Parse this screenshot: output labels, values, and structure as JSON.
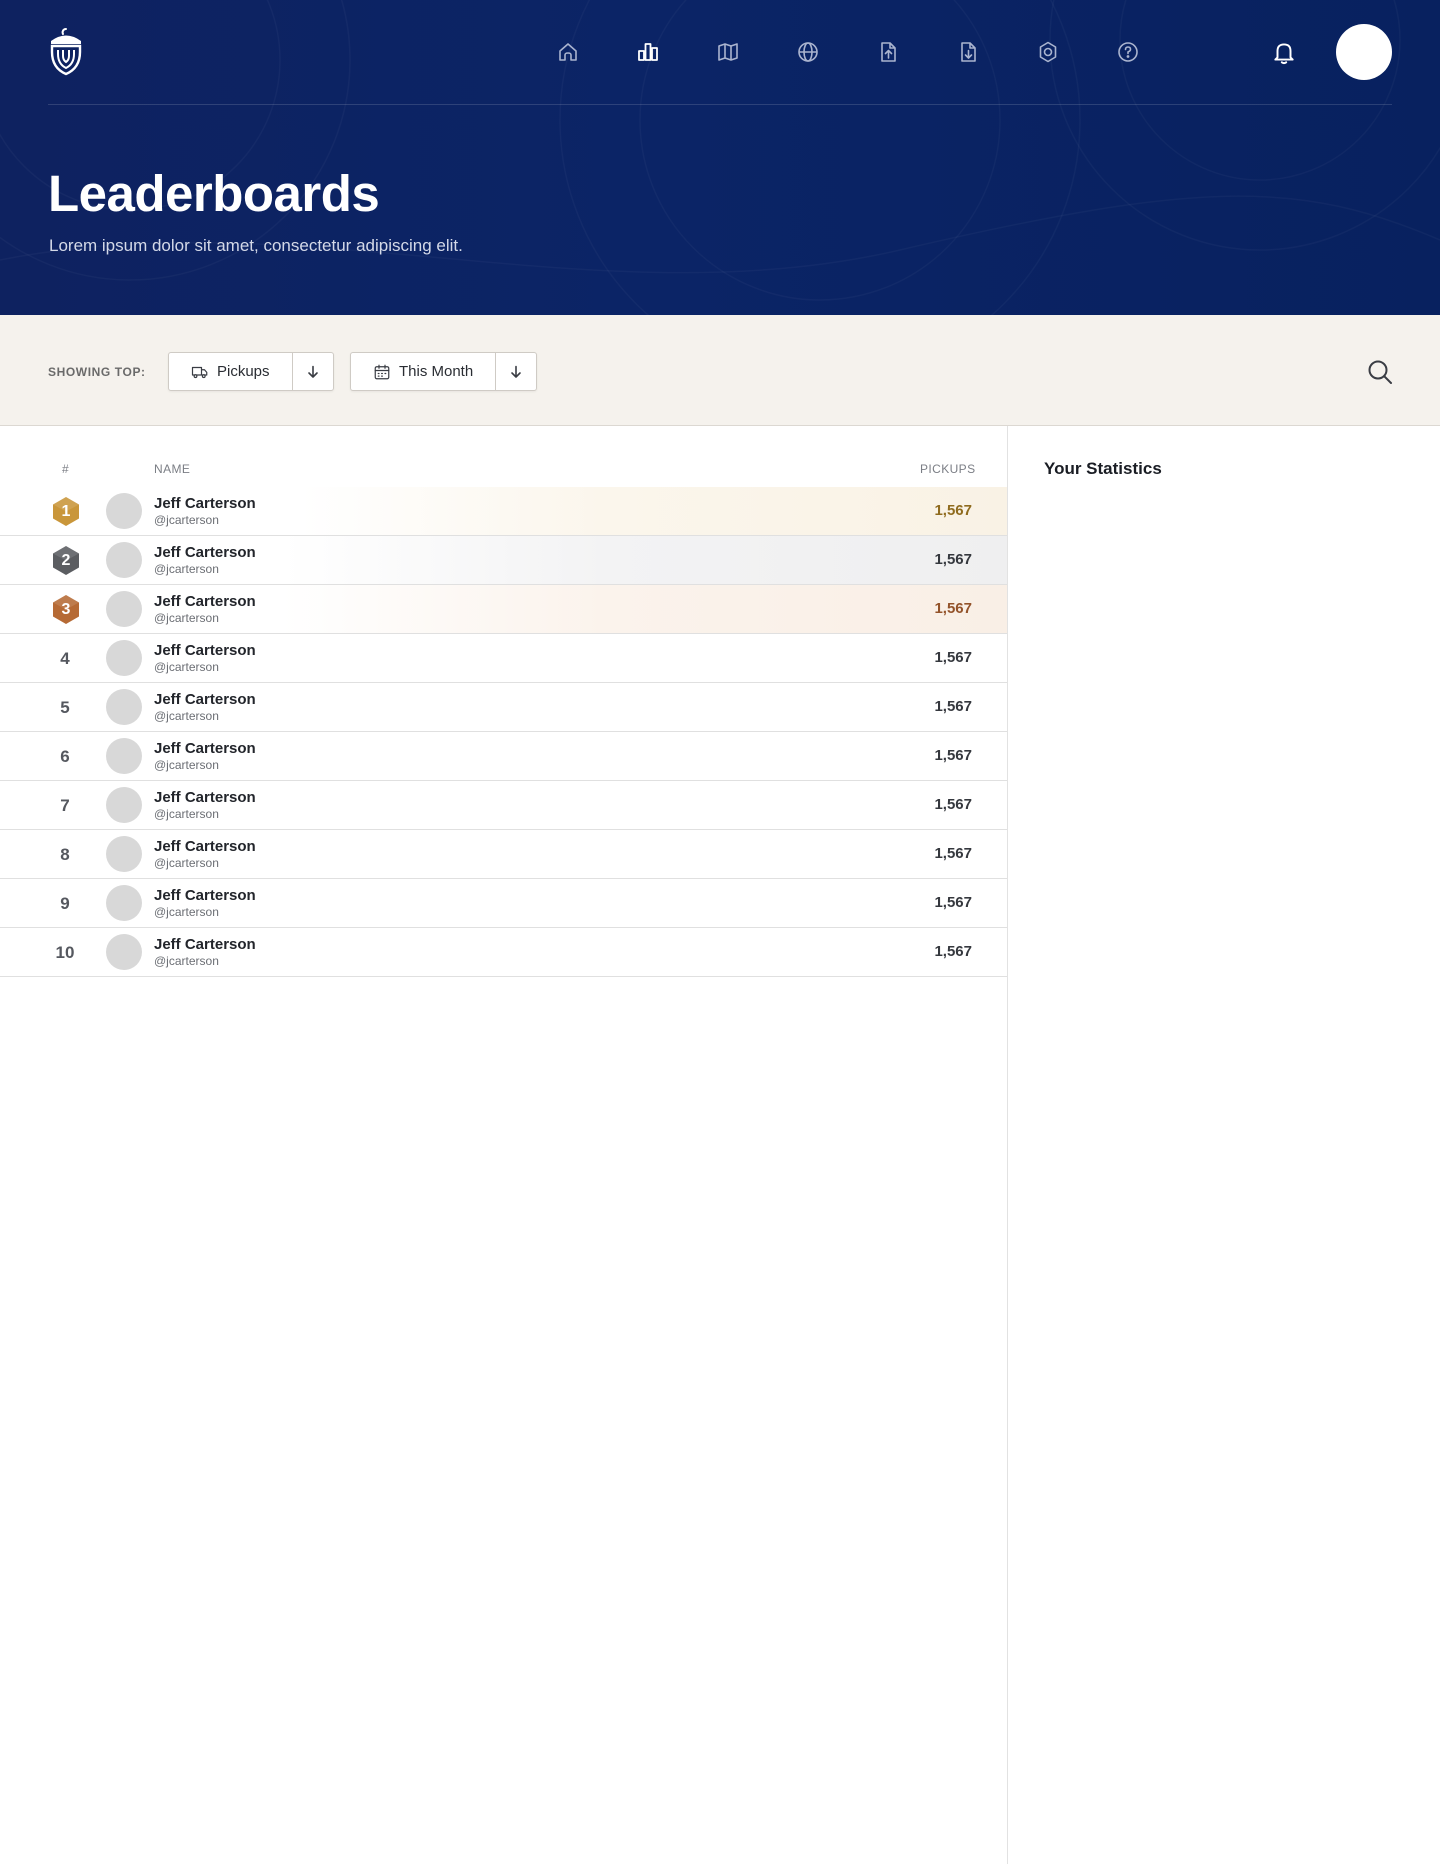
{
  "header": {
    "title": "Leaderboards",
    "subtitle": "Lorem ipsum dolor sit amet, consectetur adipiscing elit."
  },
  "nav": {
    "items": [
      {
        "icon": "home-icon",
        "active": false
      },
      {
        "icon": "leaderboard-icon",
        "active": true
      },
      {
        "icon": "map-icon",
        "active": false
      },
      {
        "icon": "globe-icon",
        "active": false
      },
      {
        "icon": "file-upload-icon",
        "active": false
      },
      {
        "icon": "file-download-icon",
        "active": false
      },
      {
        "icon": "settings-icon",
        "active": false
      },
      {
        "icon": "help-icon",
        "active": false
      }
    ]
  },
  "filters": {
    "showing_label": "SHOWING TOP:",
    "metric": {
      "label": "Pickups",
      "icon": "truck-icon"
    },
    "period": {
      "label": "This Month",
      "icon": "calendar-icon"
    }
  },
  "table": {
    "headers": {
      "rank": "#",
      "name": "NAME",
      "metric": "PICKUPS"
    },
    "rows": [
      {
        "rank": "1",
        "name": "Jeff Carterson",
        "handle": "@jcarterson",
        "value": "1,567",
        "medal": "gold"
      },
      {
        "rank": "2",
        "name": "Jeff Carterson",
        "handle": "@jcarterson",
        "value": "1,567",
        "medal": "silver"
      },
      {
        "rank": "3",
        "name": "Jeff Carterson",
        "handle": "@jcarterson",
        "value": "1,567",
        "medal": "bronze"
      },
      {
        "rank": "4",
        "name": "Jeff Carterson",
        "handle": "@jcarterson",
        "value": "1,567",
        "medal": ""
      },
      {
        "rank": "5",
        "name": "Jeff Carterson",
        "handle": "@jcarterson",
        "value": "1,567",
        "medal": ""
      },
      {
        "rank": "6",
        "name": "Jeff Carterson",
        "handle": "@jcarterson",
        "value": "1,567",
        "medal": ""
      },
      {
        "rank": "7",
        "name": "Jeff Carterson",
        "handle": "@jcarterson",
        "value": "1,567",
        "medal": ""
      },
      {
        "rank": "8",
        "name": "Jeff Carterson",
        "handle": "@jcarterson",
        "value": "1,567",
        "medal": ""
      },
      {
        "rank": "9",
        "name": "Jeff Carterson",
        "handle": "@jcarterson",
        "value": "1,567",
        "medal": ""
      },
      {
        "rank": "10",
        "name": "Jeff Carterson",
        "handle": "@jcarterson",
        "value": "1,567",
        "medal": ""
      }
    ]
  },
  "sidebar": {
    "title": "Your Statistics"
  },
  "colors": {
    "header_bg": "#0b2466",
    "filter_bg": "#f5f2ed",
    "gold": "#c9963a",
    "silver": "#5b5d61",
    "bronze": "#b66a35"
  }
}
